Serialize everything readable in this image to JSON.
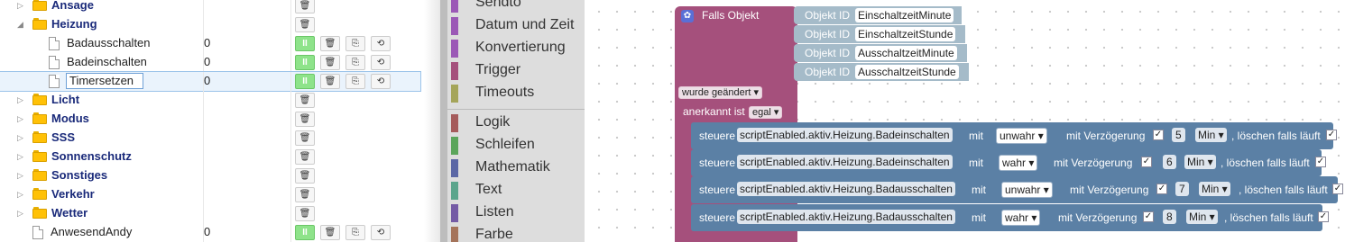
{
  "tree": {
    "rows": [
      {
        "name": "Ansage",
        "type": "folder",
        "toggle": "▷",
        "value": ""
      },
      {
        "name": "Heizung",
        "type": "folder",
        "toggle": "◢",
        "value": ""
      },
      {
        "name": "Badausschalten",
        "type": "file",
        "toggle": "",
        "value": "0"
      },
      {
        "name": "Badeinschalten",
        "type": "file",
        "toggle": "",
        "value": "0"
      },
      {
        "name": "Timersetzen",
        "type": "file",
        "toggle": "",
        "value": "0"
      },
      {
        "name": "Licht",
        "type": "folder",
        "toggle": "▷",
        "value": ""
      },
      {
        "name": "Modus",
        "type": "folder",
        "toggle": "▷",
        "value": ""
      },
      {
        "name": "SSS",
        "type": "folder",
        "toggle": "▷",
        "value": ""
      },
      {
        "name": "Sonnenschutz",
        "type": "folder",
        "toggle": "▷",
        "value": ""
      },
      {
        "name": "Sonstiges",
        "type": "folder",
        "toggle": "▷",
        "value": ""
      },
      {
        "name": "Verkehr",
        "type": "folder",
        "toggle": "▷",
        "value": ""
      },
      {
        "name": "Wetter",
        "type": "folder",
        "toggle": "▷",
        "value": ""
      },
      {
        "name": "AnwesendAndy",
        "type": "file",
        "toggle": "",
        "value": "0"
      }
    ],
    "icons": {
      "pause": "II",
      "delete": "🗑",
      "copy": "⎘",
      "refresh": "⟲"
    }
  },
  "categories": [
    {
      "label": "Sendto",
      "color": "#9b59b6"
    },
    {
      "label": "Datum und Zeit",
      "color": "#9b59b6"
    },
    {
      "label": "Konvertierung",
      "color": "#9b59b6"
    },
    {
      "label": "Trigger",
      "color": "#a5507c"
    },
    {
      "label": "Timeouts",
      "color": "#a5a55a"
    },
    {
      "label": "Logik",
      "color": "#a55b5b"
    },
    {
      "label": "Schleifen",
      "color": "#5ba55b"
    },
    {
      "label": "Mathematik",
      "color": "#5b67a5"
    },
    {
      "label": "Text",
      "color": "#5ba58c"
    },
    {
      "label": "Listen",
      "color": "#745ba5"
    },
    {
      "label": "Farbe",
      "color": "#a5745b"
    }
  ],
  "event_block": {
    "title": "Falls Objekt",
    "objects_label": "Objekt ID",
    "objects": [
      "EinschaltzeitMinute",
      "EinschaltzeitStunde",
      "AusschaltzeitMinute",
      "AusschaltzeitStunde"
    ],
    "condition": "wurde geändert",
    "ack_label": "anerkannt ist",
    "ack_value": "egal"
  },
  "actions": [
    {
      "verb": "steuere",
      "target": "scriptEnabled.aktiv.Heizung.Badeinschalten",
      "mit": "mit",
      "value": "unwahr",
      "delay_label": "mit Verzögerung",
      "delay": "5",
      "unit": "Min",
      "clear_label": ", löschen falls läuft"
    },
    {
      "verb": "steuere",
      "target": "scriptEnabled.aktiv.Heizung.Badeinschalten",
      "mit": "mit",
      "value": "wahr",
      "delay_label": "mit Verzögerung",
      "delay": "6",
      "unit": "Min",
      "clear_label": ", löschen falls läuft"
    },
    {
      "verb": "steuere",
      "target": "scriptEnabled.aktiv.Heizung.Badausschalten",
      "mit": "mit",
      "value": "unwahr",
      "delay_label": "mit Verzögerung",
      "delay": "7",
      "unit": "Min",
      "clear_label": ", löschen falls läuft"
    },
    {
      "verb": "steuere",
      "target": "scriptEnabled.aktiv.Heizung.Badausschalten",
      "mit": "mit",
      "value": "wahr",
      "delay_label": "mit Verzögerung",
      "delay": "8",
      "unit": "Min",
      "clear_label": ", löschen falls läuft"
    }
  ]
}
